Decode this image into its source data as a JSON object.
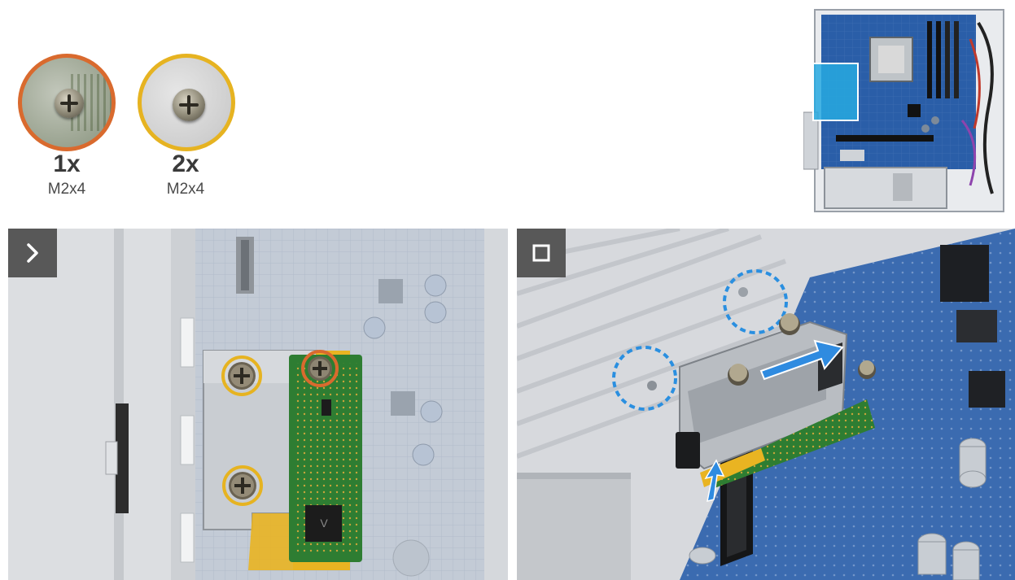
{
  "screws": [
    {
      "count": "1x",
      "size": "M2x4",
      "ring_color": "#d96a2e"
    },
    {
      "count": "2x",
      "size": "M2x4",
      "ring_color": "#e6b321"
    }
  ],
  "overview": {
    "icon": "desktop-chassis-overview-icon",
    "highlight_color": "#27a9e1"
  },
  "steps": [
    {
      "icon": "chevron-right-icon"
    },
    {
      "icon": "stop-square-icon"
    }
  ],
  "colors": {
    "badge": "#585858",
    "arrow": "#2f8be0",
    "callout_dash": "#2a8fe0",
    "pcb_green": "#2e7d32",
    "motherboard_blue": "#2a5ea8"
  }
}
